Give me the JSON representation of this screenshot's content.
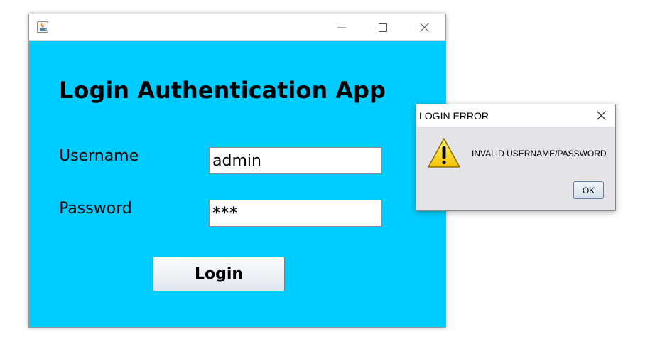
{
  "main_window": {
    "title_icon": "java-app-icon",
    "window_controls": [
      "minimize-icon",
      "maximize-icon",
      "close-icon"
    ],
    "heading": "Login Authentication App",
    "username_label": "Username",
    "username_value": "admin",
    "password_label": "Password",
    "password_value": "***",
    "login_button": "Login",
    "background_color": "#00ccff"
  },
  "error_dialog": {
    "title": "LOGIN ERROR",
    "close_icon": "close-icon",
    "icon": "warning-icon",
    "message": "INVALID USERNAME/PASSWORD",
    "ok_button": "OK"
  }
}
